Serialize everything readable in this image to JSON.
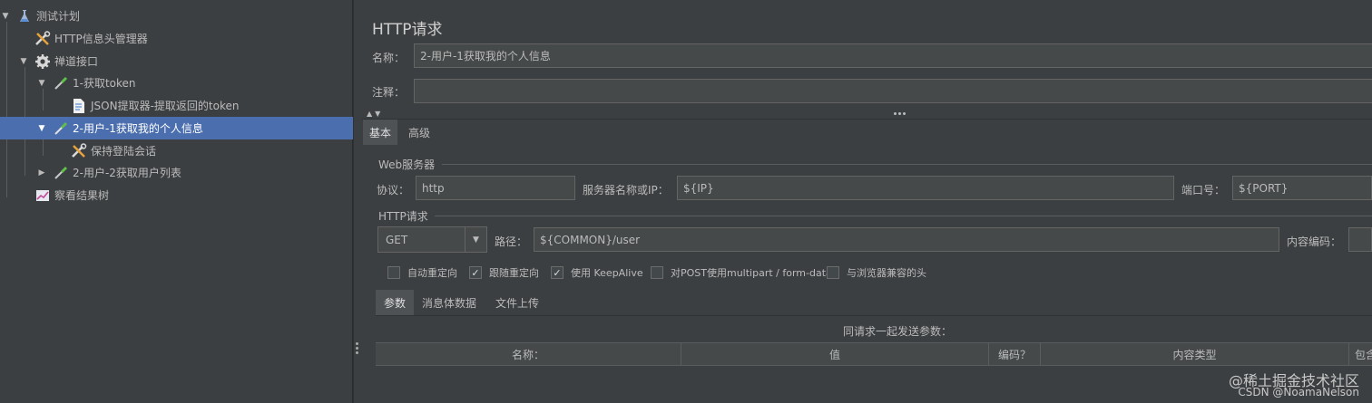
{
  "tree": {
    "items": [
      {
        "label": "测试计划",
        "icon": "test-plan-flask-icon"
      },
      {
        "label": "HTTP信息头管理器",
        "icon": "tools-icon"
      },
      {
        "label": "禅道接口",
        "icon": "gear-icon"
      },
      {
        "label": "1-获取token",
        "icon": "sampler-pipette-icon"
      },
      {
        "label": "JSON提取器-提取返回的token",
        "icon": "document-icon"
      },
      {
        "label": "2-用户-1获取我的个人信息",
        "icon": "sampler-pipette-icon"
      },
      {
        "label": "保持登陆会话",
        "icon": "tools-icon"
      },
      {
        "label": "2-用户-2获取用户列表",
        "icon": "sampler-pipette-icon"
      },
      {
        "label": "察看结果树",
        "icon": "chart-listener-icon"
      }
    ]
  },
  "panel": {
    "title": "HTTP请求",
    "name_label": "名称：",
    "name_value": "2-用户-1获取我的个人信息",
    "comment_label": "注释：",
    "comment_value": "",
    "tabs": [
      "基本",
      "高级"
    ],
    "web_server_group": "Web服务器",
    "protocol_label": "协议：",
    "protocol_value": "http",
    "server_label": "服务器名称或IP：",
    "server_value": "${IP}",
    "port_label": "端口号：",
    "port_value": "${PORT}",
    "http_request_group": "HTTP请求",
    "method_value": "GET",
    "path_label": "路径：",
    "path_value": "${COMMON}/user",
    "encoding_label": "内容编码：",
    "encoding_value": "",
    "checkboxes": [
      {
        "label": "自动重定向",
        "checked": false
      },
      {
        "label": "跟随重定向",
        "checked": true
      },
      {
        "label": "使用 KeepAlive",
        "checked": true
      },
      {
        "label": "对POST使用multipart / form-data",
        "checked": false
      },
      {
        "label": "与浏览器兼容的头",
        "checked": false
      }
    ],
    "subtabs": [
      "参数",
      "消息体数据",
      "文件上传"
    ],
    "params_caption": "同请求一起发送参数：",
    "table_headers": [
      "名称：",
      "值",
      "编码？",
      "内容类型",
      "包含"
    ]
  },
  "watermark": {
    "line1": "@稀土掘金技术社区",
    "line2": "CSDN @NoamaNelson"
  },
  "colors": {
    "background": "#3c3f41",
    "selection": "#4b6eaf",
    "field": "#45494a"
  }
}
